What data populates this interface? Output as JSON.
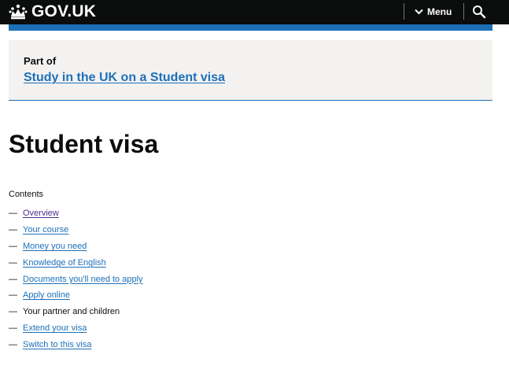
{
  "header": {
    "logo_text": "GOV.UK",
    "menu_label": "Menu",
    "icons": {
      "crown": "crown-icon",
      "chevron": "chevron-down-icon",
      "search": "search-icon"
    }
  },
  "part_of": {
    "label": "Part of",
    "link_text": "Study in the UK on a Student visa"
  },
  "page_title": "Student visa",
  "contents": {
    "heading": "Contents",
    "dash": "—",
    "items": [
      {
        "label": "Overview",
        "state": "visited-link"
      },
      {
        "label": "Your course",
        "state": "link"
      },
      {
        "label": "Money you need",
        "state": "link"
      },
      {
        "label": "Knowledge of English",
        "state": "link"
      },
      {
        "label": "Documents you'll need to apply",
        "state": "link"
      },
      {
        "label": "Apply online",
        "state": "link"
      },
      {
        "label": "Your partner and children",
        "state": "current"
      },
      {
        "label": "Extend your visa",
        "state": "link"
      },
      {
        "label": "Switch to this visa",
        "state": "link"
      }
    ]
  },
  "colors": {
    "header_bg": "#0b0c0c",
    "brand_blue": "#1d70b8",
    "visited_link": "#4c2c92",
    "panel_bg": "#f3f2f1",
    "text": "#0b0c0c"
  }
}
